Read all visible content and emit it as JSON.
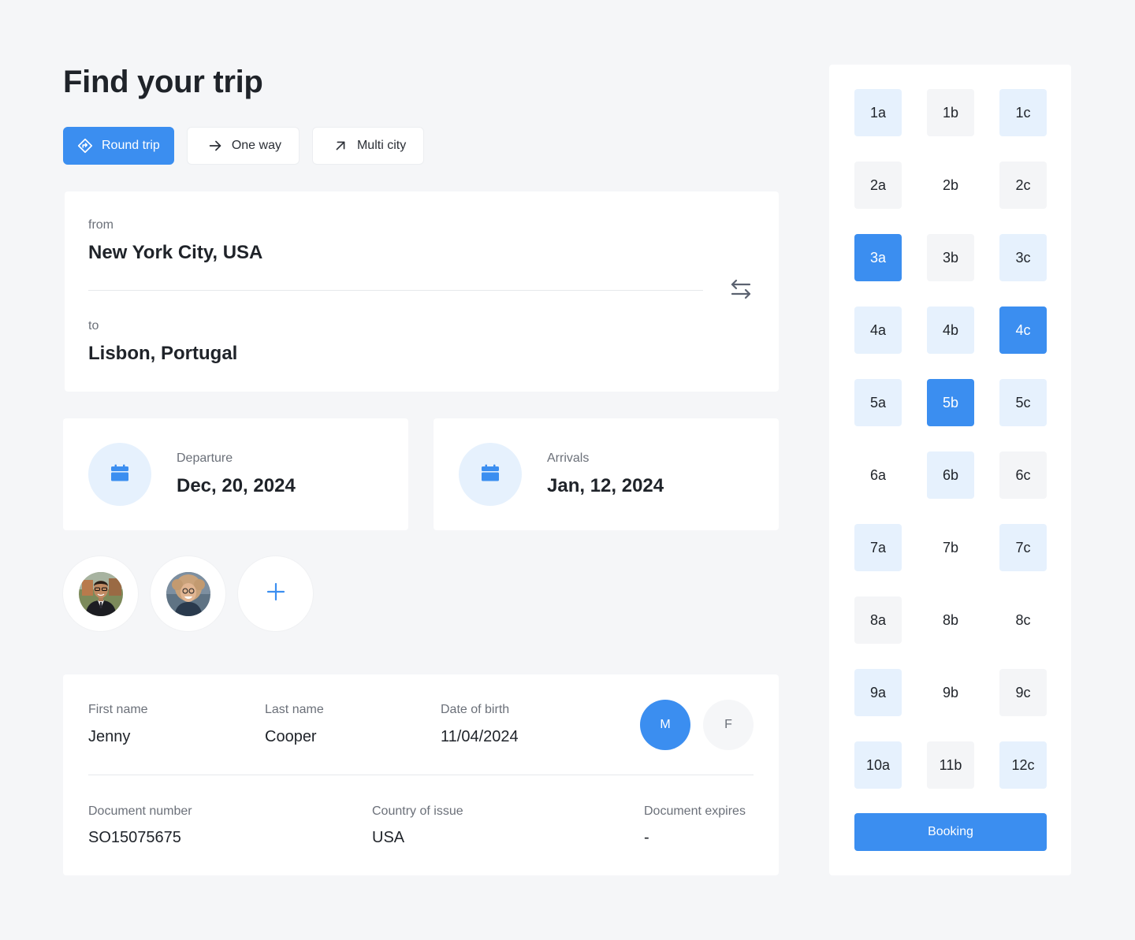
{
  "page_title": "Find your trip",
  "trip_types": [
    {
      "label": "Round trip",
      "icon": "round-trip-icon",
      "active": true
    },
    {
      "label": "One way",
      "icon": "arrow-right-icon",
      "active": false
    },
    {
      "label": "Multi city",
      "icon": "arrow-up-right-icon",
      "active": false
    }
  ],
  "route": {
    "from_label": "from",
    "from_value": "New York City, USA",
    "to_label": "to",
    "to_value": "Lisbon, Portugal",
    "swap_icon": "swap-icon"
  },
  "departure": {
    "label": "Departure",
    "value": "Dec, 20, 2024",
    "icon": "calendar-icon"
  },
  "arrival": {
    "label": "Arrivals",
    "value": "Jan, 12, 2024",
    "icon": "calendar-icon"
  },
  "passengers": {
    "avatars": [
      "avatar-man",
      "avatar-woman"
    ],
    "add_icon": "plus-icon"
  },
  "traveler": {
    "first_name_label": "First name",
    "first_name": "Jenny",
    "last_name_label": "Last name",
    "last_name": "Cooper",
    "dob_label": "Date of birth",
    "dob": "11/04/2024",
    "gender_m": "M",
    "gender_f": "F",
    "selected_gender": "M",
    "doc_number_label": "Document number",
    "doc_number": "SO15075675",
    "country_label": "Country of issue",
    "country": "USA",
    "expires_label": "Document expires",
    "expires": "-"
  },
  "seats": [
    {
      "label": "1a",
      "state": "available"
    },
    {
      "label": "1b",
      "state": "occupied"
    },
    {
      "label": "1c",
      "state": "available"
    },
    {
      "label": "2a",
      "state": "occupied"
    },
    {
      "label": "2b",
      "state": "none"
    },
    {
      "label": "2c",
      "state": "occupied"
    },
    {
      "label": "3a",
      "state": "selected"
    },
    {
      "label": "3b",
      "state": "occupied"
    },
    {
      "label": "3c",
      "state": "available"
    },
    {
      "label": "4a",
      "state": "available"
    },
    {
      "label": "4b",
      "state": "available"
    },
    {
      "label": "4c",
      "state": "selected"
    },
    {
      "label": "5a",
      "state": "available"
    },
    {
      "label": "5b",
      "state": "selected"
    },
    {
      "label": "5c",
      "state": "available"
    },
    {
      "label": "6a",
      "state": "none"
    },
    {
      "label": "6b",
      "state": "available"
    },
    {
      "label": "6c",
      "state": "occupied"
    },
    {
      "label": "7a",
      "state": "available"
    },
    {
      "label": "7b",
      "state": "none"
    },
    {
      "label": "7c",
      "state": "available"
    },
    {
      "label": "8a",
      "state": "occupied"
    },
    {
      "label": "8b",
      "state": "none"
    },
    {
      "label": "8c",
      "state": "none"
    },
    {
      "label": "9a",
      "state": "available"
    },
    {
      "label": "9b",
      "state": "none"
    },
    {
      "label": "9c",
      "state": "occupied"
    },
    {
      "label": "10a",
      "state": "available"
    },
    {
      "label": "11b",
      "state": "occupied"
    },
    {
      "label": "12c",
      "state": "available"
    }
  ],
  "booking_label": "Booking",
  "colors": {
    "accent": "#3b8ef0",
    "accent_light": "#e6f1fd",
    "occupied": "#f4f5f7",
    "background": "#f5f6f8"
  }
}
